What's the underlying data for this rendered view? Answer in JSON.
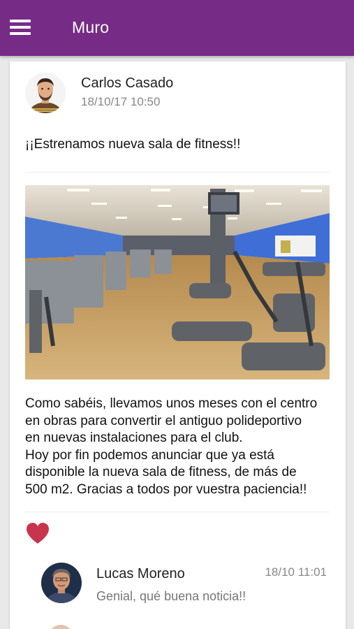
{
  "appbar": {
    "menu_icon": "hamburger-menu-icon",
    "title": "Muro",
    "color": "#762b87"
  },
  "post": {
    "author": "Carlos Casado",
    "date": "18/10/17  10:50",
    "title": "¡¡Estrenamos nueva sala de fitness!!",
    "body_lines": [
      "Como sabéis, llevamos unos meses con el centro",
      "en obras para convertir el antiguo polideportivo",
      "en nuevas instalaciones para el club.",
      "Hoy por fin podemos anunciar que ya está",
      "disponible la nueva sala de fitness, de más de",
      "500 m2. Gracias a todos por vuestra paciencia!!"
    ],
    "like_icon": "heart-icon",
    "like_color": "#c8344e"
  },
  "comments": [
    {
      "author": "Lucas Moreno",
      "time": "18/10  11:01",
      "text": "Genial, qué buena noticia!!"
    }
  ]
}
